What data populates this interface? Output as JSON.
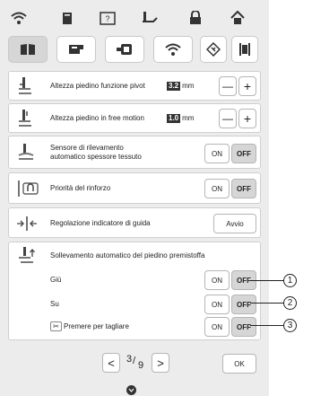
{
  "pivot": {
    "label": "Altezza piedino funzione pivot",
    "value": "3.2",
    "unit": "mm"
  },
  "free_motion": {
    "label": "Altezza piedino in free motion",
    "value": "1.0",
    "unit": "mm"
  },
  "stepper": {
    "minus": "—",
    "plus": "+"
  },
  "sensor": {
    "line1": "Sensore di rilevamento",
    "line2": "automatico spessore tessuto"
  },
  "reinforce": {
    "label": "Priorità del rinforzo"
  },
  "guide": {
    "label": "Regolazione indicatore di guida",
    "button": "Avvio"
  },
  "lift": {
    "label": "Sollevamento automatico del piedino premistoffa",
    "down": "Giù",
    "up": "Su",
    "cut": "Premere per tagliare"
  },
  "toggle": {
    "on": "ON",
    "off": "OFF"
  },
  "pager": {
    "prev": "<",
    "next": ">",
    "current": "3",
    "total": "9"
  },
  "ok": "OK",
  "callouts": [
    "1",
    "2",
    "3"
  ]
}
